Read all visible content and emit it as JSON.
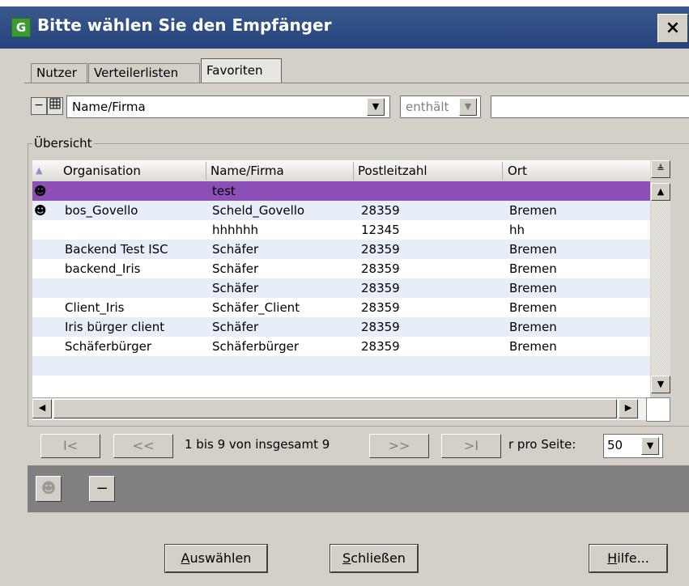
{
  "window": {
    "title": "Bitte wählen Sie den Empfänger",
    "app_icon_letter": "G",
    "close_label": "×"
  },
  "tabs": [
    {
      "label": "Nutzer",
      "active": false
    },
    {
      "label": "Verteilerlisten",
      "active": false
    },
    {
      "label": "Favoriten",
      "active": true
    }
  ],
  "filter": {
    "minus_label": "−",
    "grid_icon": "grid-icon",
    "field_value": "Name/Firma",
    "operator_value": "enthält",
    "search_value": ""
  },
  "overview": {
    "label": "Übersicht",
    "columns": [
      "Organisation",
      "Name/Firma",
      "Postleitzahl",
      "Ort"
    ],
    "rows": [
      {
        "org": "",
        "name": "test",
        "plz": "",
        "ort": "",
        "icon": true,
        "selected": true
      },
      {
        "org": "bos_Govello",
        "name": "Scheld_Govello",
        "plz": "28359",
        "ort": "Bremen",
        "icon": true,
        "selected": false
      },
      {
        "org": "",
        "name": "hhhhhh",
        "plz": "12345",
        "ort": "hh",
        "icon": false,
        "selected": false
      },
      {
        "org": "Backend Test ISC",
        "name": "Schäfer",
        "plz": "28359",
        "ort": "Bremen",
        "icon": false,
        "selected": false
      },
      {
        "org": "backend_Iris",
        "name": "Schäfer",
        "plz": "28359",
        "ort": "Bremen",
        "icon": false,
        "selected": false
      },
      {
        "org": "",
        "name": "Schäfer",
        "plz": "28359",
        "ort": "Bremen",
        "icon": false,
        "selected": false
      },
      {
        "org": "Client_Iris",
        "name": "Schäfer_Client",
        "plz": "28359",
        "ort": "Bremen",
        "icon": false,
        "selected": false
      },
      {
        "org": "Iris bürger client",
        "name": "Schäfer",
        "plz": "28359",
        "ort": "Bremen",
        "icon": false,
        "selected": false
      },
      {
        "org": "Schäferbürger",
        "name": "Schäferbürger",
        "plz": "28359",
        "ort": "Bremen",
        "icon": false,
        "selected": false
      }
    ]
  },
  "pager": {
    "first": "I<",
    "prev": "<<",
    "status": "1 bis 9 von insgesamt 9",
    "next": ">>",
    "last": ">I",
    "per_page_label": "r pro Seite:",
    "per_page_value": "50"
  },
  "actions": {
    "add_icon": "person-add-icon",
    "remove_label": "−"
  },
  "buttons": {
    "select_u": "A",
    "select_rest": "uswählen",
    "close_u": "S",
    "close_rest": "chließen",
    "help_u": "H",
    "help_rest": "ilfe..."
  },
  "colors": {
    "selection": "#8c4fb8",
    "row_alt": "#e8eef8",
    "titlebar": "#25437a"
  }
}
